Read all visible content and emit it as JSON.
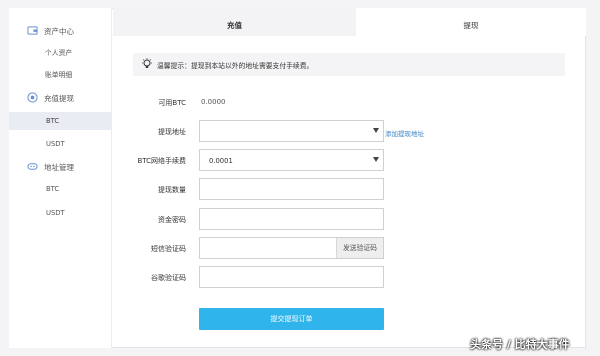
{
  "sidebar": {
    "groups": [
      {
        "icon": "wallet-icon",
        "label": "资产中心",
        "items": [
          {
            "label": "个人资产"
          },
          {
            "label": "账单明细"
          }
        ]
      },
      {
        "icon": "exchange-icon",
        "label": "充值提现",
        "items": [
          {
            "label": "BTC"
          },
          {
            "label": "USDT"
          }
        ]
      },
      {
        "icon": "address-book-icon",
        "label": "地址管理",
        "items": [
          {
            "label": "BTC"
          },
          {
            "label": "USDT"
          }
        ]
      }
    ],
    "active_item": "BTC"
  },
  "tabs": [
    {
      "label": "充值",
      "active": true
    },
    {
      "label": "提现",
      "active": false
    }
  ],
  "notice": {
    "icon": "lightbulb-icon",
    "text": "温馨提示：提现到本站以外的地址需要支付手续费。"
  },
  "form": {
    "available_label": "可用BTC",
    "available_value": "0.0000",
    "address_label": "提现地址",
    "address_value": "",
    "add_address_link": "添加提现地址",
    "fee_label": "BTC网络手续费",
    "fee_value": "0.0001",
    "amount_label": "提现数量",
    "fund_password_label": "资金密码",
    "sms_code_label": "短信验证码",
    "send_code_button": "发送验证码",
    "google_code_label": "谷歌验证码",
    "submit_button": "提交提现订单"
  },
  "colors": {
    "accent": "#30b4ec",
    "link": "#3b82c4",
    "active_bg": "#e9ecf3"
  },
  "watermark": "头条号 / 比特大事件"
}
